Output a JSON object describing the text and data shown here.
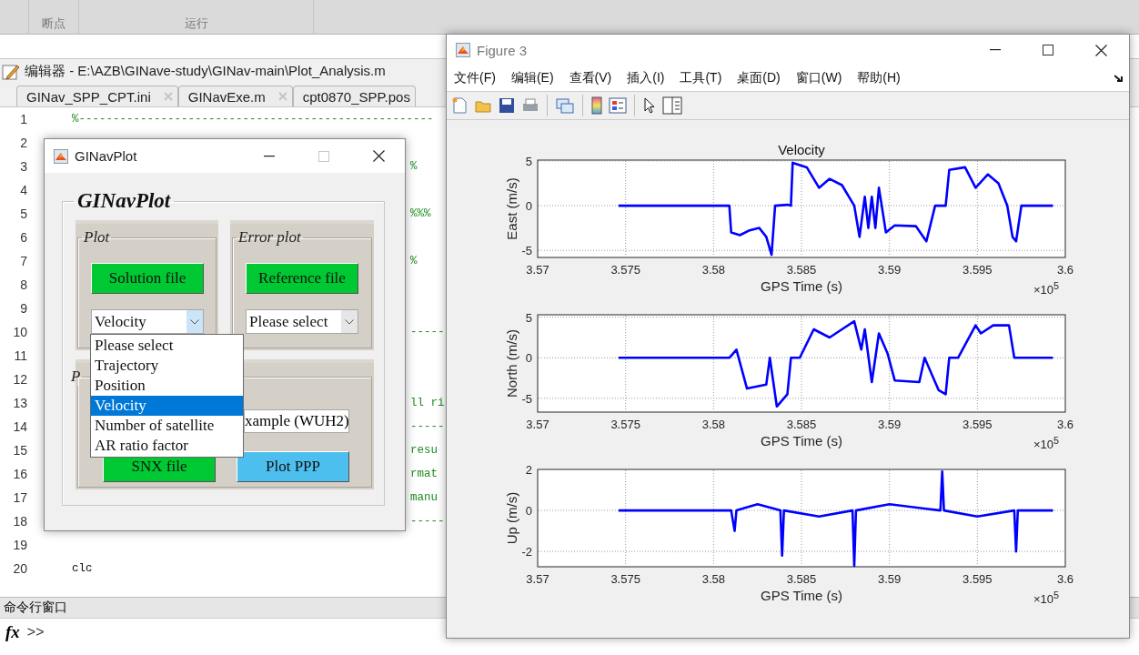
{
  "toolstrip": {
    "sections": [
      "断点",
      "运行"
    ]
  },
  "editor": {
    "title": "编辑器 - E:\\AZB\\GINave-study\\GINav-main\\Plot_Analysis.m",
    "tabs": [
      {
        "label": "GINav_SPP_CPT.ini",
        "selected": false
      },
      {
        "label": "GINavExe.m",
        "selected": false
      },
      {
        "label": "cpt0870_SPP.pos",
        "selected": false
      }
    ],
    "lines": [
      {
        "number": "1",
        "text": "%----------------------------------------------------",
        "kind": "comment"
      },
      {
        "number": "2"
      },
      {
        "number": "3",
        "text": "%",
        "kind": "tail"
      },
      {
        "number": "4"
      },
      {
        "number": "5",
        "text": "%%%",
        "kind": "tail"
      },
      {
        "number": "6"
      },
      {
        "number": "7",
        "text": "%",
        "kind": "tail"
      },
      {
        "number": "8"
      },
      {
        "number": "9"
      },
      {
        "number": "10",
        "text": "-----",
        "kind": "tail"
      },
      {
        "number": "11"
      },
      {
        "number": "12"
      },
      {
        "number": "13",
        "text": "ll ri",
        "kind": "tail"
      },
      {
        "number": "14",
        "text": "-----",
        "kind": "tail"
      },
      {
        "number": "15",
        "text": "resu",
        "kind": "tail"
      },
      {
        "number": "16",
        "text": "rmat",
        "kind": "tail"
      },
      {
        "number": "17",
        "text": "manu",
        "kind": "tail"
      },
      {
        "number": "18",
        "text": "-----",
        "kind": "tail"
      },
      {
        "number": "19"
      },
      {
        "number": "20",
        "text": "clc",
        "kind": "code"
      }
    ]
  },
  "command_window": {
    "title": "命令行窗口",
    "fx": "fx",
    "prompt": ">>"
  },
  "ginavplot": {
    "title": "GINavPlot",
    "heading": "GINavPlot",
    "plot_panel": {
      "title": "Plot",
      "button": "Solution file",
      "select": {
        "value": "Velocity",
        "open": true
      }
    },
    "error_panel": {
      "title": "Error plot",
      "button": "Reference file",
      "select": {
        "value": "Please select",
        "open": false
      }
    },
    "third_panel": {
      "title": "P",
      "field": "xample (WUH2)",
      "buttons": [
        {
          "label": "SNX file",
          "kind": "green"
        },
        {
          "label": "Plot PPP",
          "kind": "blue"
        }
      ]
    },
    "dropdown": {
      "options": [
        {
          "label": "Please select",
          "selected": false
        },
        {
          "label": "Trajectory",
          "selected": false
        },
        {
          "label": "Position",
          "selected": false
        },
        {
          "label": "Velocity",
          "selected": true
        },
        {
          "label": "Number of satellite",
          "selected": false
        },
        {
          "label": "AR ratio factor",
          "selected": false
        }
      ]
    }
  },
  "figure": {
    "title": "Figure 3",
    "menu": [
      "文件(F)",
      "编辑(E)",
      "查看(V)",
      "插入(I)",
      "工具(T)",
      "桌面(D)",
      "窗口(W)",
      "帮助(H)"
    ],
    "axes": [
      {
        "exponent_label": "×10$^{5}$",
        "chart_data": {
          "type": "line",
          "title": "Velocity",
          "xlabel": "GPS Time (s)",
          "ylabel": "East (m/s)",
          "x": [
            3.5746,
            3.5809,
            3.581,
            3.5815,
            3.582,
            3.5826,
            3.583,
            3.5833,
            3.5835,
            3.5842,
            3.5844,
            3.5845,
            3.5853,
            3.586,
            3.5866,
            3.5873,
            3.588,
            3.5883,
            3.5886,
            3.5888,
            3.589,
            3.5892,
            3.5894,
            3.5898,
            3.5903,
            3.5915,
            3.5921,
            3.5926,
            3.5932,
            3.5934,
            3.5943,
            3.5949,
            3.5956,
            3.5962,
            3.5967,
            3.597,
            3.5972,
            3.5975,
            3.5993
          ],
          "series": [
            {
              "color": "#0000ff",
              "values": [
                0,
                0,
                -3,
                -3.3,
                -2.8,
                -2.5,
                -3.5,
                -5.5,
                0,
                0.1,
                0,
                4.8,
                4.3,
                2,
                3,
                2.3,
                0,
                -3.5,
                1,
                -2.5,
                1,
                -2.5,
                2,
                -3,
                -2.2,
                -2.3,
                -4,
                0,
                0,
                4,
                4.3,
                2,
                3.5,
                2.5,
                0,
                -3.5,
                -4,
                0,
                0
              ]
            }
          ],
          "xlim": [
            3.57,
            3.6
          ],
          "ylim": [
            -5.8,
            5.1
          ],
          "xticks": [
            3.57,
            3.575,
            3.58,
            3.585,
            3.59,
            3.595,
            3.6
          ],
          "yticks": [
            -5,
            0,
            5
          ],
          "grid": true
        }
      },
      {
        "exponent_label": "×10$^{5}$",
        "chart_data": {
          "type": "line",
          "xlabel": "GPS Time (s)",
          "ylabel": "North (m/s)",
          "x": [
            3.5746,
            3.5809,
            3.5813,
            3.5819,
            3.583,
            3.5832,
            3.5836,
            3.5842,
            3.5844,
            3.5849,
            3.5857,
            3.5866,
            3.5873,
            3.588,
            3.5884,
            3.5886,
            3.589,
            3.5894,
            3.5899,
            3.5903,
            3.5917,
            3.592,
            3.5928,
            3.5932,
            3.5934,
            3.5939,
            3.5949,
            3.5952,
            3.5959,
            3.5968,
            3.5971,
            3.5993
          ],
          "series": [
            {
              "color": "#0000ff",
              "values": [
                0,
                0,
                1,
                -3.8,
                -3.3,
                0,
                -6,
                -4.5,
                0,
                0,
                3.5,
                2.5,
                3.5,
                4.5,
                1,
                3.5,
                -3,
                3,
                0.5,
                -2.8,
                -3,
                0,
                -4,
                -4.5,
                0,
                0,
                4,
                3,
                4,
                4,
                0,
                0
              ]
            }
          ],
          "xlim": [
            3.57,
            3.6
          ],
          "ylim": [
            -6.7,
            5.3
          ],
          "xticks": [
            3.57,
            3.575,
            3.58,
            3.585,
            3.59,
            3.595,
            3.6
          ],
          "yticks": [
            -5,
            0,
            5
          ],
          "grid": true
        }
      },
      {
        "exponent_label": "×10$^{5}$",
        "chart_data": {
          "type": "line",
          "xlabel": "GPS Time (s)",
          "ylabel": "Up (m/s)",
          "x": [
            3.5746,
            3.581,
            3.5812,
            3.5813,
            3.5825,
            3.5838,
            3.5839,
            3.584,
            3.586,
            3.5879,
            3.588,
            3.5881,
            3.59,
            3.5929,
            3.593,
            3.5931,
            3.595,
            3.5971,
            3.5972,
            3.5973,
            3.5993
          ],
          "series": [
            {
              "color": "#0000ff",
              "values": [
                0,
                0,
                -1,
                0,
                0.3,
                0,
                -2.2,
                0,
                -0.3,
                0,
                -2.7,
                0,
                0.3,
                0,
                1.9,
                0,
                -0.3,
                0,
                -2,
                0,
                0
              ]
            }
          ],
          "xlim": [
            3.57,
            3.6
          ],
          "ylim": [
            -2.75,
            2
          ],
          "xticks": [
            3.57,
            3.575,
            3.58,
            3.585,
            3.59,
            3.595,
            3.6
          ],
          "yticks": [
            -2,
            0,
            2
          ],
          "grid": true
        }
      }
    ]
  }
}
